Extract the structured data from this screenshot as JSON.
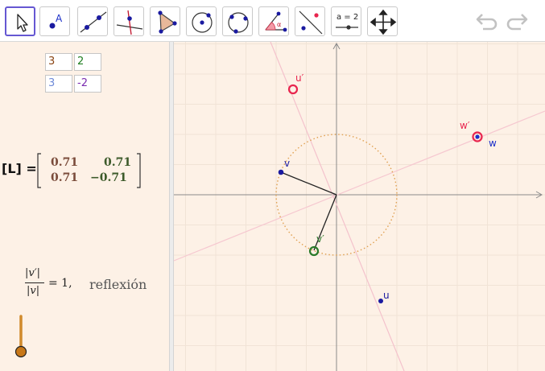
{
  "toolbar": {
    "tools": [
      {
        "name": "move-tool",
        "active": true
      },
      {
        "name": "point-tool"
      },
      {
        "name": "line-tool"
      },
      {
        "name": "perpendicular-line-tool"
      },
      {
        "name": "polygon-tool"
      },
      {
        "name": "circle-center-point-tool"
      },
      {
        "name": "circle-three-points-tool"
      },
      {
        "name": "angle-tool"
      },
      {
        "name": "reflect-about-line-tool"
      },
      {
        "name": "slider-tool",
        "label": "a = 2"
      },
      {
        "name": "move-graphics-view-tool"
      }
    ],
    "undo_icon": "undo-icon",
    "redo_icon": "redo-icon"
  },
  "algebra": {
    "spreadsheet": [
      {
        "value": "3",
        "color": "#8b4513"
      },
      {
        "value": "2",
        "color": "#1e7d1e"
      },
      {
        "value": "3",
        "color": "#6f8ad8"
      },
      {
        "value": "-2",
        "color": "#7a2bb0"
      }
    ],
    "matrix": {
      "label": "[L] =",
      "rows": [
        [
          "0.71",
          "0.71"
        ],
        [
          "0.71",
          "−0.71"
        ]
      ],
      "colors": [
        "#7a4b3a",
        "#3c5a2a"
      ]
    },
    "ratio": {
      "numerator": "|v′|",
      "denominator": "|v|",
      "equals": "= 1,",
      "word": "reflexión"
    }
  },
  "graphics": {
    "points": [
      {
        "label": "u′",
        "color": "#e8254e"
      },
      {
        "label": "w′",
        "color": "#e8254e"
      },
      {
        "label": "w",
        "color": "#1a2ec8"
      },
      {
        "label": "v",
        "color": "#1a1aa0"
      },
      {
        "label": "v′",
        "color": "#2a7a2a"
      },
      {
        "label": "u",
        "color": "#1a1aa0"
      }
    ],
    "colors": {
      "grid": "#f1e3d6",
      "axis": "#8a8a8a",
      "mirror": "#f4c2cc",
      "circle": "#e0a050"
    }
  }
}
